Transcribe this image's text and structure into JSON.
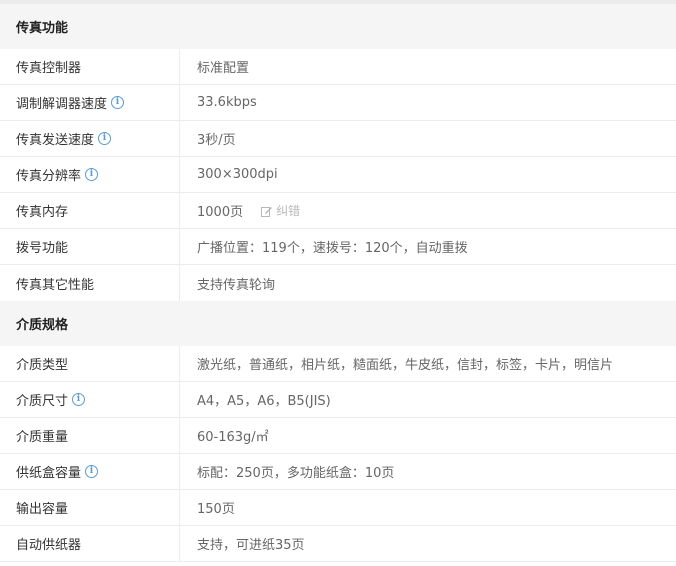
{
  "sections": [
    {
      "title": "传真功能",
      "rows": [
        {
          "label": "传真控制器",
          "value": "标准配置",
          "info": false
        },
        {
          "label": "调制解调器速度",
          "value": "33.6kbps",
          "info": true
        },
        {
          "label": "传真发送速度",
          "value": "3秒/页",
          "info": true
        },
        {
          "label": "传真分辨率",
          "value": "300×300dpi",
          "info": true
        },
        {
          "label": "传真内存",
          "value": "1000页",
          "info": false,
          "correction": "纠错"
        },
        {
          "label": "拨号功能",
          "value": "广播位置：119个，速拨号：120个，自动重拨",
          "info": false
        },
        {
          "label": "传真其它性能",
          "value": "支持传真轮询",
          "info": false
        }
      ]
    },
    {
      "title": "介质规格",
      "rows": [
        {
          "label": "介质类型",
          "value": "激光纸，普通纸，相片纸，糙面纸，牛皮纸，信封，标签，卡片，明信片",
          "info": false
        },
        {
          "label": "介质尺寸",
          "value": "A4，A5，A6，B5(JIS)",
          "info": true
        },
        {
          "label": "介质重量",
          "value": "60-163g/㎡",
          "info": false
        },
        {
          "label": "供纸盒容量",
          "value": "标配：250页，多功能纸盒：10页",
          "info": true
        },
        {
          "label": "输出容量",
          "value": "150页",
          "info": false
        },
        {
          "label": "自动供纸器",
          "value": "支持，可进纸35页",
          "info": false
        }
      ]
    }
  ],
  "icons": {
    "info": "info-circle-icon",
    "correct": "pencil-edit-icon"
  },
  "colors": {
    "info_blue": "#5b9bd5",
    "section_bg": "#f5f5f5",
    "border": "#ececec"
  }
}
